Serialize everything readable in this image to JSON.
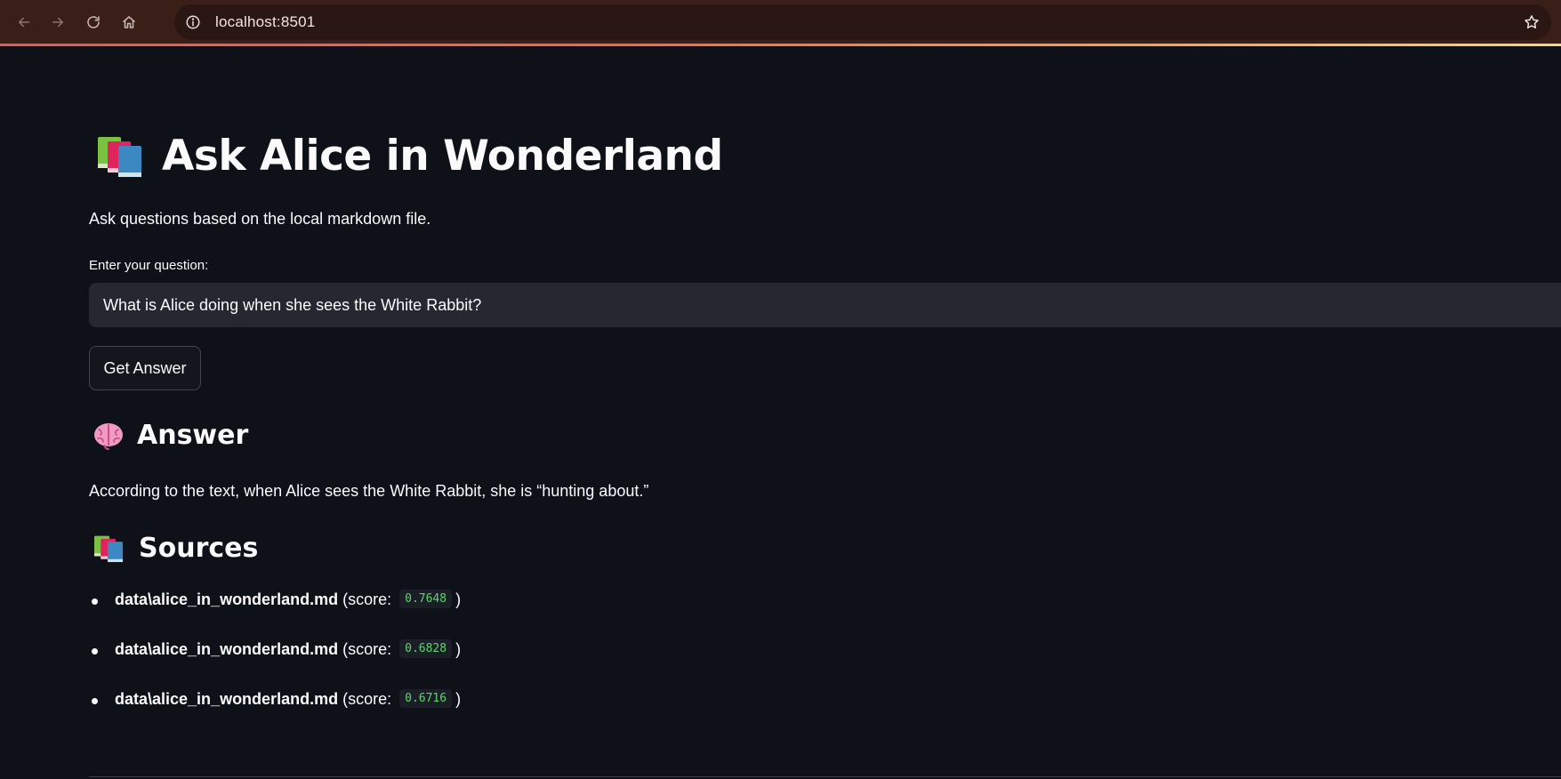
{
  "browser": {
    "url": "localhost:8501"
  },
  "app": {
    "title": "Ask Alice in Wonderland",
    "subtitle": "Ask questions based on the local markdown file.",
    "input_label": "Enter your question:",
    "question_value": "What is Alice doing when she sees the White Rabbit?",
    "button_label": "Get Answer",
    "answer_heading": "Answer",
    "answer_text": "According to the text, when Alice sees the White Rabbit, she is “hunting about.”",
    "sources_heading": "Sources",
    "sources": [
      {
        "file": "data\\alice_in_wonderland.md",
        "score_prefix": "(score:",
        "score": "0.7648",
        "score_suffix": ")"
      },
      {
        "file": "data\\alice_in_wonderland.md",
        "score_prefix": "(score:",
        "score": "0.6828",
        "score_suffix": ")"
      },
      {
        "file": "data\\alice_in_wonderland.md",
        "score_prefix": "(score:",
        "score": "0.6716",
        "score_suffix": ")"
      }
    ]
  },
  "icons": {
    "title": "books-icon",
    "answer": "brain-icon",
    "sources": "books-icon"
  },
  "colors": {
    "background": "#0e1117",
    "input_background": "#262730",
    "score_text": "#5fd56d"
  }
}
